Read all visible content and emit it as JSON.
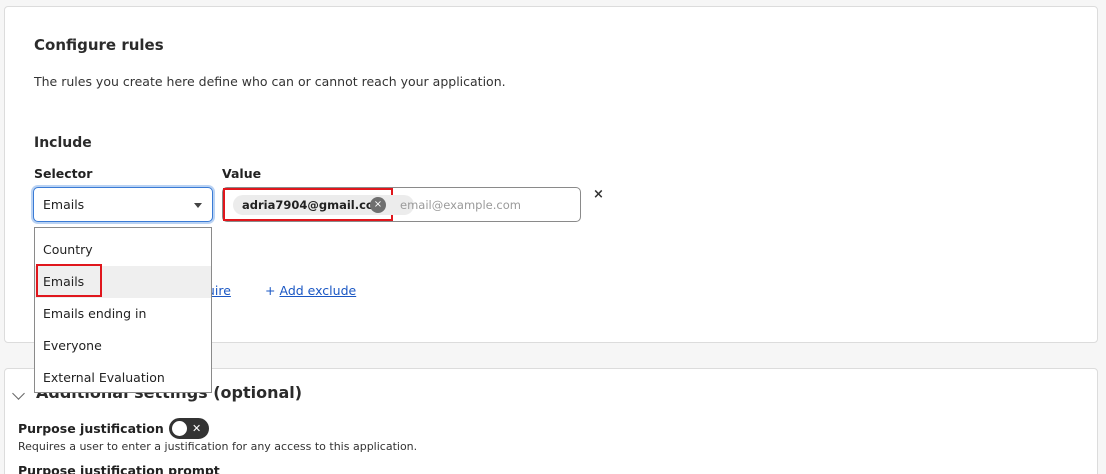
{
  "configure": {
    "title": "Configure rules",
    "description": "The rules you create here define who can or cannot reach your application.",
    "include_heading": "Include",
    "selector_label": "Selector",
    "value_label": "Value",
    "selector_value": "Emails",
    "chip_value": "adria7904@gmail.com",
    "chip_remove": "×",
    "value_placeholder": "email@example.com",
    "row_remove": "×",
    "add_require_partial": "quire",
    "add_exclude_plus": "+",
    "add_exclude": "Add exclude"
  },
  "dropdown": {
    "options": [
      "Country",
      "Emails",
      "Emails ending in",
      "Everyone",
      "External Evaluation"
    ],
    "selected": "Emails"
  },
  "additional": {
    "heading": "Additional settings (optional)",
    "purpose_label": "Purpose justification",
    "toggle_mark": "✕",
    "purpose_desc": "Requires a user to enter a justification for any access to this application.",
    "prompt_label": "Purpose justification prompt"
  },
  "colors": {
    "highlight": "#e0161c",
    "link": "#1a57c4",
    "focus": "#3a7bd5"
  }
}
